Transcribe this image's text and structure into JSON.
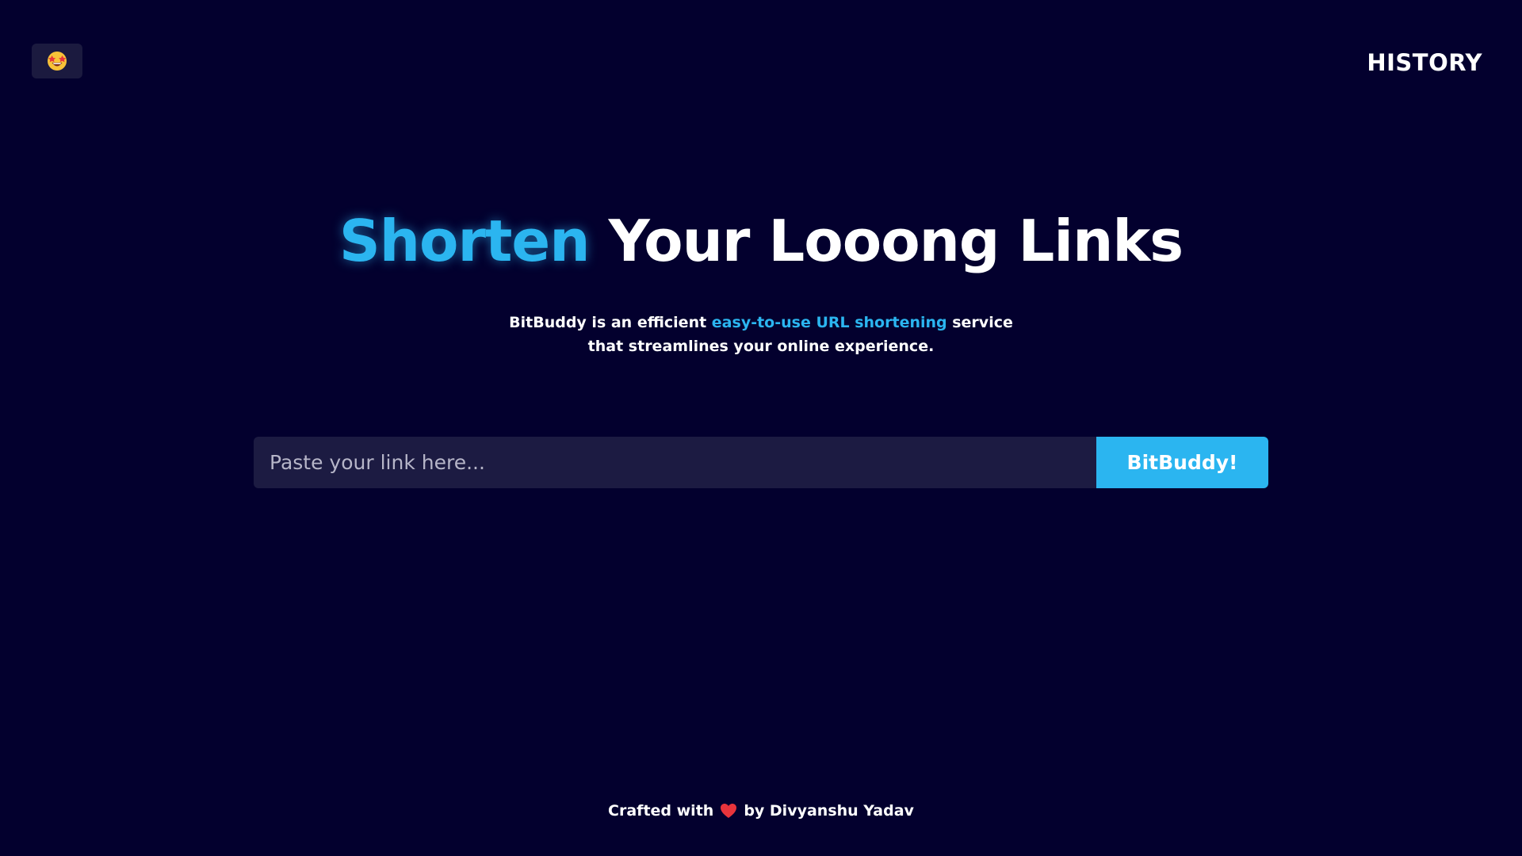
{
  "header": {
    "theme_toggle_icon": "star-struck-emoji-icon",
    "history_label": "HISTORY"
  },
  "hero": {
    "title_accent": "Shorten",
    "title_rest": "Your Looong Links",
    "subtitle_part1": "BitBuddy is an efficient ",
    "subtitle_highlight": "easy-to-use URL shortening",
    "subtitle_part2": " service",
    "subtitle_line2": "that streamlines your online experience."
  },
  "form": {
    "input_placeholder": "Paste your link here...",
    "input_value": "",
    "submit_label": "BitBuddy!"
  },
  "footer": {
    "prefix": "Crafted with",
    "icon": "heart-icon",
    "suffix": "by Divyanshu Yadav"
  },
  "colors": {
    "background": "#03002e",
    "accent": "#2bb5f0",
    "input_background": "#1c1b42",
    "button_background": "#2bb5f0",
    "heart": "#e8343c"
  }
}
